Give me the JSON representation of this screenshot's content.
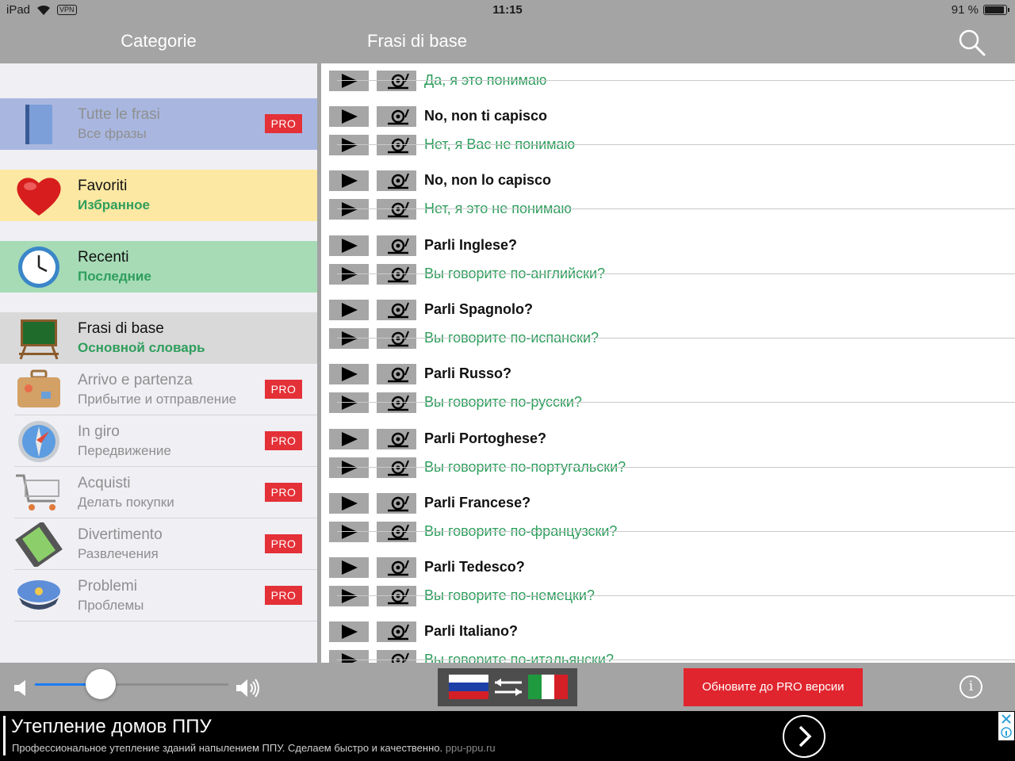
{
  "status_bar": {
    "device": "iPad",
    "vpn": "VPN",
    "time": "11:15",
    "battery": "91 %",
    "battery_level": 0.91
  },
  "nav": {
    "left_title": "Categorie",
    "title": "Frasi di base",
    "search_icon": "search-icon"
  },
  "sidebar": {
    "items": [
      {
        "title": "Tutte le frasi",
        "subtitle": "Все фразы",
        "icon": "book-icon",
        "pro": "PRO",
        "bg": "#a9b7e0"
      },
      {
        "title": "Favoriti",
        "subtitle": "Избранное",
        "icon": "heart-icon",
        "bg": "#fce8a3"
      },
      {
        "title": "Recenti",
        "subtitle": "Последние",
        "icon": "clock-icon",
        "bg": "#a6dbb6"
      },
      {
        "title": "Frasi di base",
        "subtitle": "Основной словарь",
        "icon": "chalkboard-icon",
        "bg": "#d9d9d9"
      },
      {
        "title": "Arrivo e partenza",
        "subtitle": "Прибытие и отправление",
        "icon": "suitcase-icon",
        "pro": "PRO"
      },
      {
        "title": "In giro",
        "subtitle": "Передвижение",
        "icon": "compass-icon",
        "pro": "PRO"
      },
      {
        "title": "Acquisti",
        "subtitle": "Делать покупки",
        "icon": "shopping-cart-icon",
        "pro": "PRO"
      },
      {
        "title": "Divertimento",
        "subtitle": "Развлечения",
        "icon": "film-icon",
        "pro": "PRO"
      },
      {
        "title": "Problemi",
        "subtitle": "Проблемы",
        "icon": "police-cap-icon",
        "pro": "PRO"
      }
    ]
  },
  "phrases": {
    "partial_ru": "Да, я это понимаю",
    "items": [
      {
        "it": "No, non ti capisco",
        "ru": "Нет, я Вас не понимаю"
      },
      {
        "it": "No, non lo capisco",
        "ru": "Нет, я это не понимаю"
      },
      {
        "it": "Parli Inglese?",
        "ru": "Вы говорите по-английски?"
      },
      {
        "it": "Parli Spagnolo?",
        "ru": "Вы говорите по-испански?"
      },
      {
        "it": "Parli Russo?",
        "ru": "Вы говорите по-русски?"
      },
      {
        "it": "Parli Portoghese?",
        "ru": "Вы говорите по-португальски?"
      },
      {
        "it": "Parli Francese?",
        "ru": "Вы говорите по-французски?"
      },
      {
        "it": "Parli Tedesco?",
        "ru": "Вы говорите по-немецки?"
      },
      {
        "it": "Parli Italiano?",
        "ru": "Вы говорите по-итальянски?"
      }
    ],
    "play_icon": "play-icon",
    "slow_icon": "snail-icon"
  },
  "toolbar": {
    "volume_level": 0.34,
    "lang_switch_icons": [
      "russia-flag-icon",
      "swap-arrows-icon",
      "italy-flag-icon"
    ],
    "upgrade_label": "Обновите до PRO версии",
    "info_icon": "info-icon",
    "info_glyph": "i"
  },
  "ad": {
    "title": "Утепление домов ППУ",
    "description": "Профессиональное утепление зданий напылением ППУ. Сделаем быстро и качественно.",
    "domain": "ppu-ppu.ru",
    "go_icon": "chevron-right-icon",
    "adchoices_icon": "ad-choices-icon"
  }
}
